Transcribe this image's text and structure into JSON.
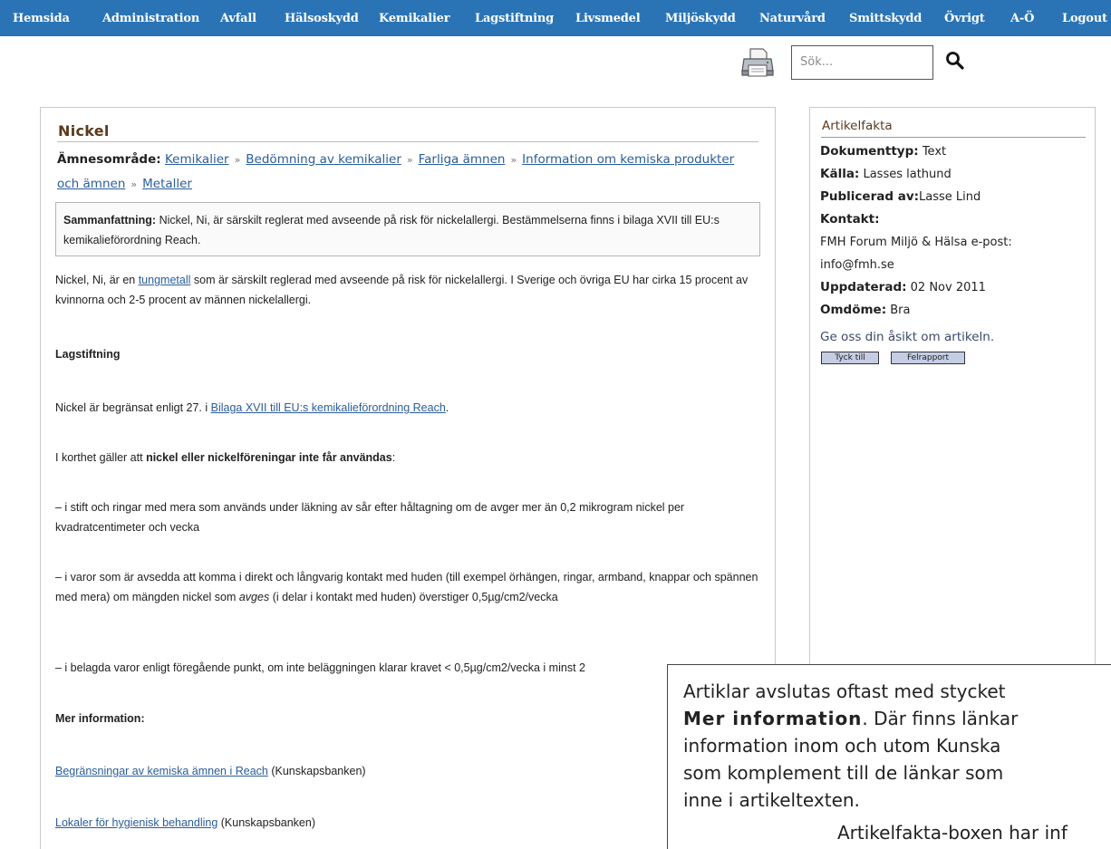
{
  "nav": {
    "items": [
      "Hemsida",
      "Administration",
      "Avfall",
      "Hälsoskydd",
      "Kemikalier",
      "Lagstiftning",
      "Livsmedel",
      "Miljöskydd",
      "Naturvård",
      "Smittskydd",
      "Övrigt",
      "A-Ö",
      "Logout"
    ]
  },
  "search": {
    "placeholder": "Sök..."
  },
  "icons": {
    "print": "printer-icon",
    "search": "magnifier-icon"
  },
  "colors": {
    "nav_bg": "#2a74b5",
    "title": "#5a3b1e",
    "link": "#2a5d9a",
    "button": "#c4cde4"
  },
  "article": {
    "title": "Nickel",
    "breadcrumb_label": "Ämnesområde:",
    "breadcrumb": [
      "Kemikalier",
      "Bedömning av kemikalier",
      "Farliga ämnen",
      "Information om kemiska produkter och ämnen",
      "Metaller"
    ],
    "summary_label": "Sammanfattning:",
    "summary_text": " Nickel, Ni, är särskilt reglerat med avseende på risk för nickelallergi. Bestämmelserna finns i bilaga XVII till EU:s kemikalieförordning Reach.",
    "p1_before": "Nickel, Ni, är en ",
    "p1_link": "tungmetall",
    "p1_after": " som är särskilt reglerad med avseende på risk för nickelallergi. I Sverige och övriga EU har cirka 15 procent av kvinnorna och 2-5 procent av männen nickelallergi.",
    "heading_law": "Lagstiftning",
    "p2_before": "Nickel är begränsat enligt 27. i ",
    "p2_link": "Bilaga XVII till EU:s kemikalieförordning Reach",
    "p2_after": ".",
    "p3_before": "I korthet gäller att ",
    "p3_bold": "nickel eller nickelföreningar inte får användas",
    "p3_after": ":",
    "p4": "– i stift och ringar med mera som används under läkning av sår efter håltagning om de avger mer än 0,2 mikrogram nickel per kvadratcentimeter och vecka",
    "p5_before": " – i varor som är avsedda att komma i direkt och långvarig kontakt med huden (till exempel örhängen, ringar, armband, knappar och spännen med mera) om mängden nickel som ",
    "p5_italic": "avges",
    "p5_after": " (i delar i kontakt med huden) överstiger 0,5µg/cm2/vecka",
    "p6": "– i belagda varor enligt föregående punkt, om inte beläggningen klarar kravet < 0,5µg/cm2/vecka i minst 2",
    "heading_more": "Mer information:",
    "more_1_link": "Begränsningar av kemiska ämnen i Reach",
    "more_1_after": " (Kunskapsbanken)",
    "more_2_link": "Lokaler för hygienisk behandling",
    "more_2_after": " (Kunskapsbanken)"
  },
  "sidebar": {
    "title": "Artikelfakta",
    "doc_type_label": "Dokumenttyp:",
    "doc_type": " Text",
    "source_label": "Källa:",
    "source": " Lasses lathund",
    "published_label": "Publicerad av:",
    "published": "Lasse Lind",
    "contact_label": "Kontakt:",
    "contact_line1": "FMH Forum Miljö & Hälsa e-post:",
    "contact_line2": "info@fmh.se",
    "updated_label": "Uppdaterad:",
    "updated": " 02 Nov 2011",
    "rating_label": "Omdöme:",
    "rating": " Bra",
    "cta": "Ge oss din åsikt om artikeln.",
    "btn_feedback": "Tyck till",
    "btn_error": "Felrapport"
  },
  "overlay": {
    "line1": "Artiklar avslutas oftast med stycket",
    "line2_bold": "Mer information",
    "line2_after": ". Där finns länkar",
    "line3": "information inom och utom Kunska",
    "line4": "som komplement till de länkar som",
    "line5": "inne i artikeltexten.",
    "line6": "Artikelfakta-boxen har inf"
  }
}
